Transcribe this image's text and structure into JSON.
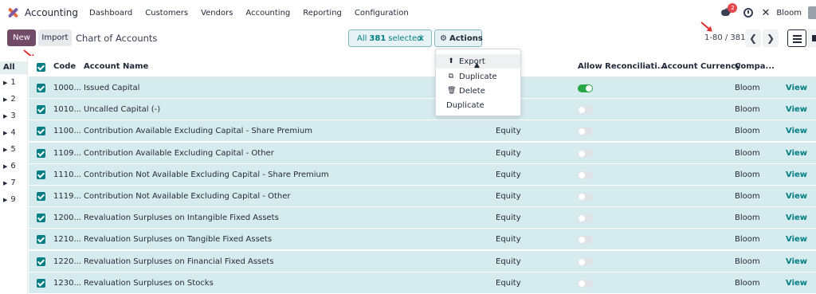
{
  "app": {
    "name": "Accounting",
    "menu": [
      "Dashboard",
      "Customers",
      "Vendors",
      "Accounting",
      "Reporting",
      "Configuration"
    ],
    "notification_count": "2",
    "company": "Bloom",
    "tools_glyph": "✕"
  },
  "control": {
    "new_label": "New",
    "import_label": "Import",
    "title": "Chart of Accounts",
    "selection_prefix": "All",
    "selection_count": "381",
    "selection_suffix": "selected",
    "clear_glyph": "✕",
    "actions_label": "Actions",
    "pager": "1-80 / 381",
    "prev_glyph": "❮",
    "next_glyph": "❯"
  },
  "actions_menu": [
    {
      "label": "Export",
      "icon": "⬆"
    },
    {
      "label": "Duplicate",
      "icon": "⧉"
    },
    {
      "label": "Delete",
      "icon": "🗑"
    },
    {
      "label": "Duplicate",
      "icon": ""
    }
  ],
  "sidebar": {
    "all_label": "All",
    "groups": [
      "1",
      "2",
      "3",
      "4",
      "5",
      "6",
      "7",
      "9"
    ]
  },
  "table": {
    "columns": {
      "code": "Code",
      "name": "Account Name",
      "reconcile": "Allow Reconciliati...",
      "currency": "Account Currency",
      "company": "Compa..."
    },
    "view_label": "View",
    "rows": [
      {
        "code": "1000...",
        "name": "Issued Capital",
        "type": "",
        "reconcile": true,
        "company": "Bloom"
      },
      {
        "code": "1010...",
        "name": "Uncalled Capital (-)",
        "type": "",
        "reconcile": false,
        "company": "Bloom"
      },
      {
        "code": "1100...",
        "name": "Contribution Available Excluding Capital - Share Premium",
        "type": "Equity",
        "reconcile": false,
        "company": "Bloom"
      },
      {
        "code": "1109...",
        "name": "Contribution Available Excluding Capital - Other",
        "type": "Equity",
        "reconcile": false,
        "company": "Bloom"
      },
      {
        "code": "1110...",
        "name": "Contribution Not Available Excluding Capital - Share Premium",
        "type": "Equity",
        "reconcile": false,
        "company": "Bloom"
      },
      {
        "code": "1119...",
        "name": "Contribution Not Available Excluding Capital - Other",
        "type": "Equity",
        "reconcile": false,
        "company": "Bloom"
      },
      {
        "code": "1200...",
        "name": "Revaluation Surpluses on Intangible Fixed Assets",
        "type": "Equity",
        "reconcile": false,
        "company": "Bloom"
      },
      {
        "code": "1210...",
        "name": "Revaluation Surpluses on Tangible Fixed Assets",
        "type": "Equity",
        "reconcile": false,
        "company": "Bloom"
      },
      {
        "code": "1220...",
        "name": "Revaluation Surpluses on Financial Fixed Assets",
        "type": "Equity",
        "reconcile": false,
        "company": "Bloom"
      },
      {
        "code": "1230...",
        "name": "Revaluation Surpluses on Stocks",
        "type": "Equity",
        "reconcile": false,
        "company": "Bloom"
      }
    ]
  },
  "colors": {
    "brand": "#714b67",
    "accent": "#017e84",
    "selected_row": "#d6ebee",
    "annotation_arrow": "#e03131"
  }
}
